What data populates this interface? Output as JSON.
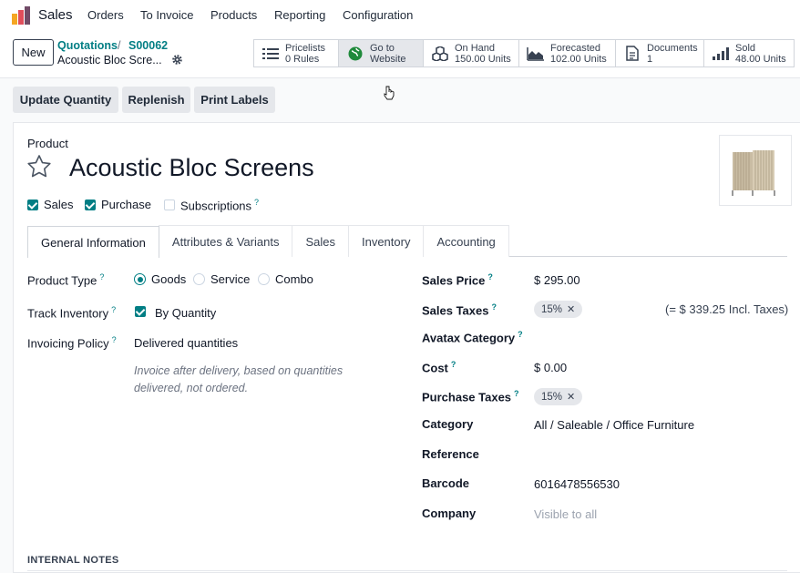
{
  "nav": {
    "app_name": "Sales",
    "menu": [
      "Orders",
      "To Invoice",
      "Products",
      "Reporting",
      "Configuration"
    ]
  },
  "control": {
    "new_label": "New",
    "breadcrumb": [
      "Quotations",
      "S00062"
    ],
    "record_name": "Acoustic Bloc Scre...",
    "smart_buttons": [
      {
        "icon": "list-icon",
        "title": "Pricelists",
        "value": "0 Rules"
      },
      {
        "icon": "globe-icon",
        "title": "Go to",
        "value": "Website"
      },
      {
        "icon": "cubes-icon",
        "title": "On Hand",
        "value": "150.00 Units"
      },
      {
        "icon": "area-chart-icon",
        "title": "Forecasted",
        "value": "102.00 Units"
      },
      {
        "icon": "document-icon",
        "title": "Documents",
        "value": "1"
      },
      {
        "icon": "signal-icon",
        "title": "Sold",
        "value": "48.00 Units"
      }
    ]
  },
  "actions": [
    "Update Quantity",
    "Replenish",
    "Print Labels"
  ],
  "product": {
    "label": "Product",
    "name": "Acoustic Bloc Screens",
    "flags": [
      {
        "label": "Sales",
        "checked": true
      },
      {
        "label": "Purchase",
        "checked": true
      },
      {
        "label": "Subscriptions",
        "checked": false,
        "help": "?"
      }
    ]
  },
  "tabs": [
    "General Information",
    "Attributes & Variants",
    "Sales",
    "Inventory",
    "Accounting"
  ],
  "left": {
    "product_type_label": "Product Type",
    "product_type_options": [
      "Goods",
      "Service",
      "Combo"
    ],
    "product_type_selected": "Goods",
    "track_inventory_label": "Track Inventory",
    "track_inventory_value": "By Quantity",
    "invoicing_policy_label": "Invoicing Policy",
    "invoicing_policy_value": "Delivered quantities",
    "invoicing_note": "Invoice after delivery, based on quantities delivered, not ordered."
  },
  "right": {
    "sales_price_label": "Sales Price",
    "sales_price": "$ 295.00",
    "sales_taxes_label": "Sales Taxes",
    "sales_tax_tag": "15%",
    "incl_taxes": "(= $ 339.25 Incl. Taxes)",
    "avatax_label": "Avatax Category",
    "cost_label": "Cost",
    "cost": "$ 0.00",
    "purchase_taxes_label": "Purchase Taxes",
    "purchase_tax_tag": "15%",
    "category_label": "Category",
    "category": "All / Saleable / Office Furniture",
    "reference_label": "Reference",
    "barcode_label": "Barcode",
    "barcode": "6016478556530",
    "company_label": "Company",
    "company_placeholder": "Visible to all"
  },
  "help_mark": "?",
  "remove_mark": "✕",
  "internal_notes_label": "INTERNAL NOTES",
  "colors": {
    "accent": "#017e84",
    "brand": "#714b67"
  }
}
